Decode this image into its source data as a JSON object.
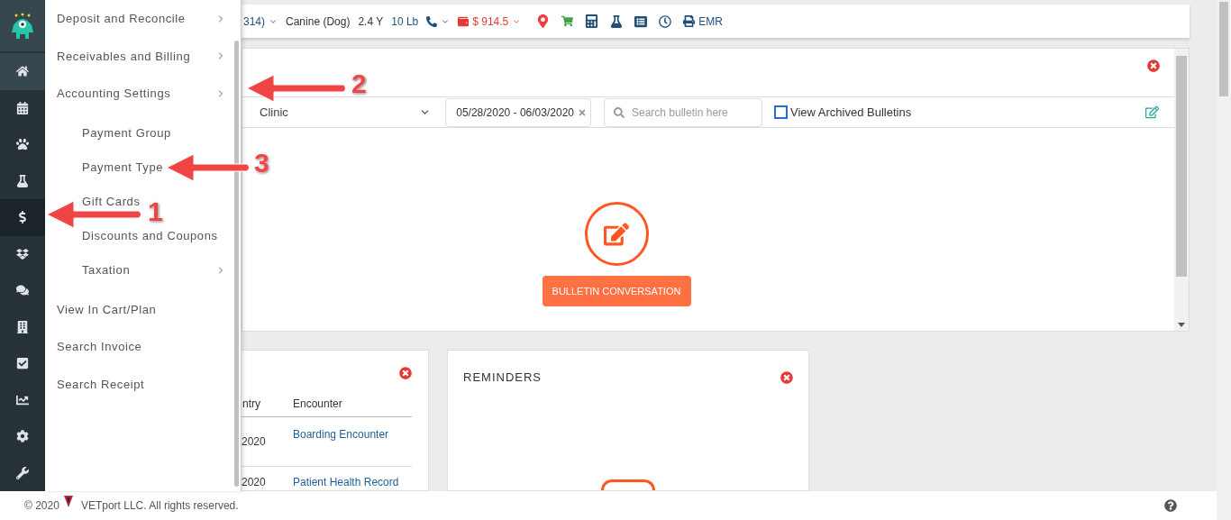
{
  "sidebar": {
    "items": [
      {
        "selected": false,
        "current": true
      },
      {
        "selected": false,
        "current": false
      },
      {
        "selected": false,
        "current": false
      },
      {
        "selected": false,
        "current": false
      },
      {
        "selected": true,
        "current": false
      },
      {
        "selected": false,
        "current": false
      },
      {
        "selected": false,
        "current": false
      },
      {
        "selected": false,
        "current": false
      },
      {
        "selected": false,
        "current": false
      },
      {
        "selected": false,
        "current": false
      },
      {
        "selected": false,
        "current": false
      },
      {
        "selected": false,
        "current": false
      }
    ]
  },
  "menu": {
    "items": [
      {
        "label": "Deposit and Reconcile",
        "has_submenu": true
      },
      {
        "label": "Receivables and Billing",
        "has_submenu": true
      },
      {
        "label": "Accounting Settings",
        "has_submenu": true,
        "children": [
          {
            "label": "Payment Group"
          },
          {
            "label": "Payment Type"
          },
          {
            "label": "Gift Cards"
          },
          {
            "label": "Discounts and Coupons"
          },
          {
            "label": "Taxation",
            "has_submenu": true
          }
        ]
      },
      {
        "label": "View In Cart/Plan"
      },
      {
        "label": "Search Invoice"
      },
      {
        "label": "Search Receipt"
      }
    ]
  },
  "top_bar": {
    "patient_fragment": "314)",
    "species": "Canine (Dog)",
    "age": "2.4 Y",
    "weight": "10 Lb",
    "balance": "$ 914.5",
    "emr_label": "EMR"
  },
  "bulletin_panel": {
    "clinic_select": "Clinic",
    "date_range": "05/28/2020 - 06/03/2020",
    "search": {
      "placeholder": "Search bulletin here"
    },
    "archived_checkbox": {
      "label": "View Archived Bulletins",
      "checked": false
    },
    "action_button": "BULLETIN CONVERSATION"
  },
  "history_card": {
    "columns": [
      "ntry",
      "Encounter"
    ],
    "rows": [
      {
        "column_1": "2020",
        "encounter": "Boarding Encounter"
      },
      {
        "column_1": "2020",
        "encounter": "Patient Health Record"
      }
    ]
  },
  "reminders_card": {
    "title": "REMINDERS"
  },
  "annotations": [
    {
      "label": "1"
    },
    {
      "label": "2"
    },
    {
      "label": "3"
    }
  ],
  "footer": {
    "copyright": "© 2020",
    "company": "VETport LLC. All rights reserved."
  }
}
